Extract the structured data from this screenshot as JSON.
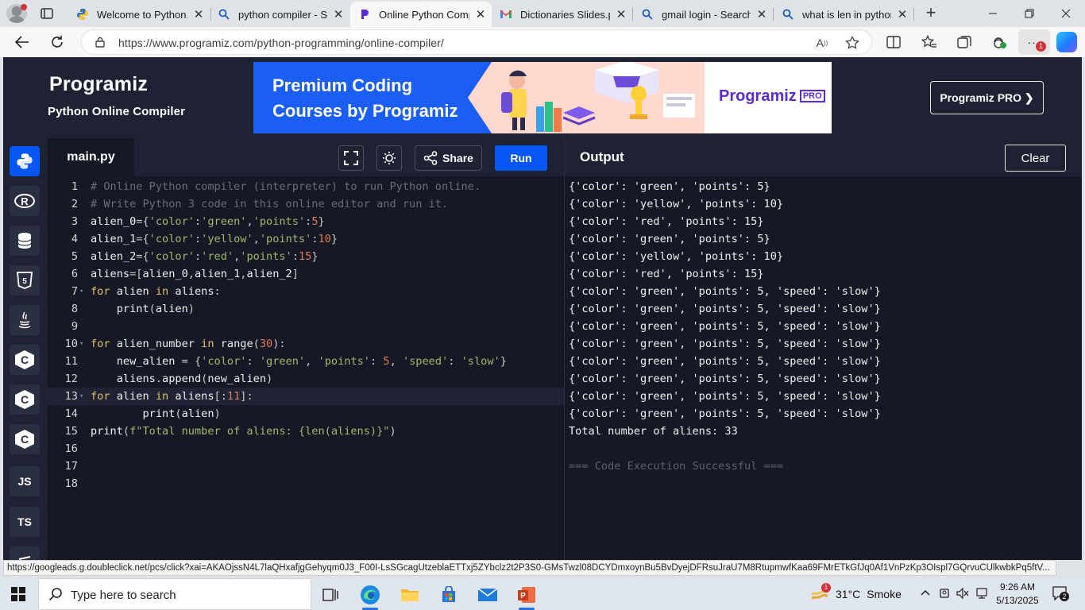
{
  "browser": {
    "tabs": [
      {
        "title": "Welcome to Python.o",
        "icon": "python-icon"
      },
      {
        "title": "python compiler - Sea",
        "icon": "search-icon"
      },
      {
        "title": "Online Python Compil",
        "icon": "programiz-icon",
        "active": true
      },
      {
        "title": "Dictionaries Slides.ppt",
        "icon": "gmail-icon"
      },
      {
        "title": "gmail login - Search",
        "icon": "search-icon"
      },
      {
        "title": "what is len in python",
        "icon": "search-icon"
      }
    ],
    "url": "https://www.programiz.com/python-programming/online-compiler/",
    "more_badge": "1"
  },
  "header": {
    "logo": "Programiz",
    "subtitle": "Python Online Compiler",
    "ad_text_line1": "Premium Coding",
    "ad_text_line2": "Courses by Programiz",
    "ad_logo": "Programiz",
    "ad_logo_badge": "PRO",
    "pro_button": "Programiz PRO ❯"
  },
  "sidebar": {
    "items": [
      {
        "name": "python",
        "label": "",
        "active": true
      },
      {
        "name": "r",
        "label": "R"
      },
      {
        "name": "sql",
        "label": ""
      },
      {
        "name": "html",
        "label": "5"
      },
      {
        "name": "java",
        "label": ""
      },
      {
        "name": "c",
        "label": "C"
      },
      {
        "name": "cpp",
        "label": "C"
      },
      {
        "name": "csharp",
        "label": "C"
      },
      {
        "name": "js",
        "label": "JS"
      },
      {
        "name": "ts",
        "label": "TS"
      },
      {
        "name": "more",
        "label": ""
      }
    ]
  },
  "editor": {
    "file_name": "main.py",
    "share_label": "Share",
    "run_label": "Run",
    "lines": [
      "# Online Python compiler (interpreter) to run Python online.",
      "# Write Python 3 code in this online editor and run it.",
      "alien_0={'color':'green','points':5}",
      "alien_1={'color':'yellow','points':10}",
      "alien_2={'color':'red','points':15}",
      "aliens=[alien_0,alien_1,alien_2]",
      "for alien in aliens:",
      "    print(alien)",
      "",
      "for alien_number in range(30):",
      "    new_alien = {'color': 'green', 'points': 5, 'speed': 'slow'}",
      "    aliens.append(new_alien)",
      "for alien in aliens[:11]:",
      "        print(alien)",
      "print(f\"Total number of aliens: {len(aliens)}\")",
      "",
      "",
      ""
    ]
  },
  "output": {
    "title": "Output",
    "clear_label": "Clear",
    "lines": [
      "{'color': 'green', 'points': 5}",
      "{'color': 'yellow', 'points': 10}",
      "{'color': 'red', 'points': 15}",
      "{'color': 'green', 'points': 5}",
      "{'color': 'yellow', 'points': 10}",
      "{'color': 'red', 'points': 15}",
      "{'color': 'green', 'points': 5, 'speed': 'slow'}",
      "{'color': 'green', 'points': 5, 'speed': 'slow'}",
      "{'color': 'green', 'points': 5, 'speed': 'slow'}",
      "{'color': 'green', 'points': 5, 'speed': 'slow'}",
      "{'color': 'green', 'points': 5, 'speed': 'slow'}",
      "{'color': 'green', 'points': 5, 'speed': 'slow'}",
      "{'color': 'green', 'points': 5, 'speed': 'slow'}",
      "{'color': 'green', 'points': 5, 'speed': 'slow'}",
      "Total number of aliens: 33",
      "",
      "=== Code Execution Successful ==="
    ]
  },
  "status_url": "https://googleads.g.doubleclick.net/pcs/click?xai=AKAOjssN4L7laQHxafjgGehyqm0J3_F00I-LsSGcagUtzeblaETTxj5ZYbclz2t2P3S0-GMsTwzl08DCYDmxoynBu5BvDyejDFRsuJraU7M8RtupmwfKaa69FMrETkGfJq0Af1VnPzKp3OIspl7GQrvuCUlkwbkPq5ftV...",
  "taskbar": {
    "search_placeholder": "Type here to search",
    "weather_temp": "31°C",
    "weather_desc": "Smoke",
    "weather_badge": "1",
    "time": "9:26 AM",
    "date": "5/13/2025",
    "notification_count": "2"
  },
  "colors": {
    "page_bg": "#1e2232",
    "editor_bg": "#161925",
    "accent": "#0556f3",
    "comment": "#676d7e",
    "keyword": "#e0c06b",
    "string": "#9fb96a",
    "number": "#e07b53"
  }
}
